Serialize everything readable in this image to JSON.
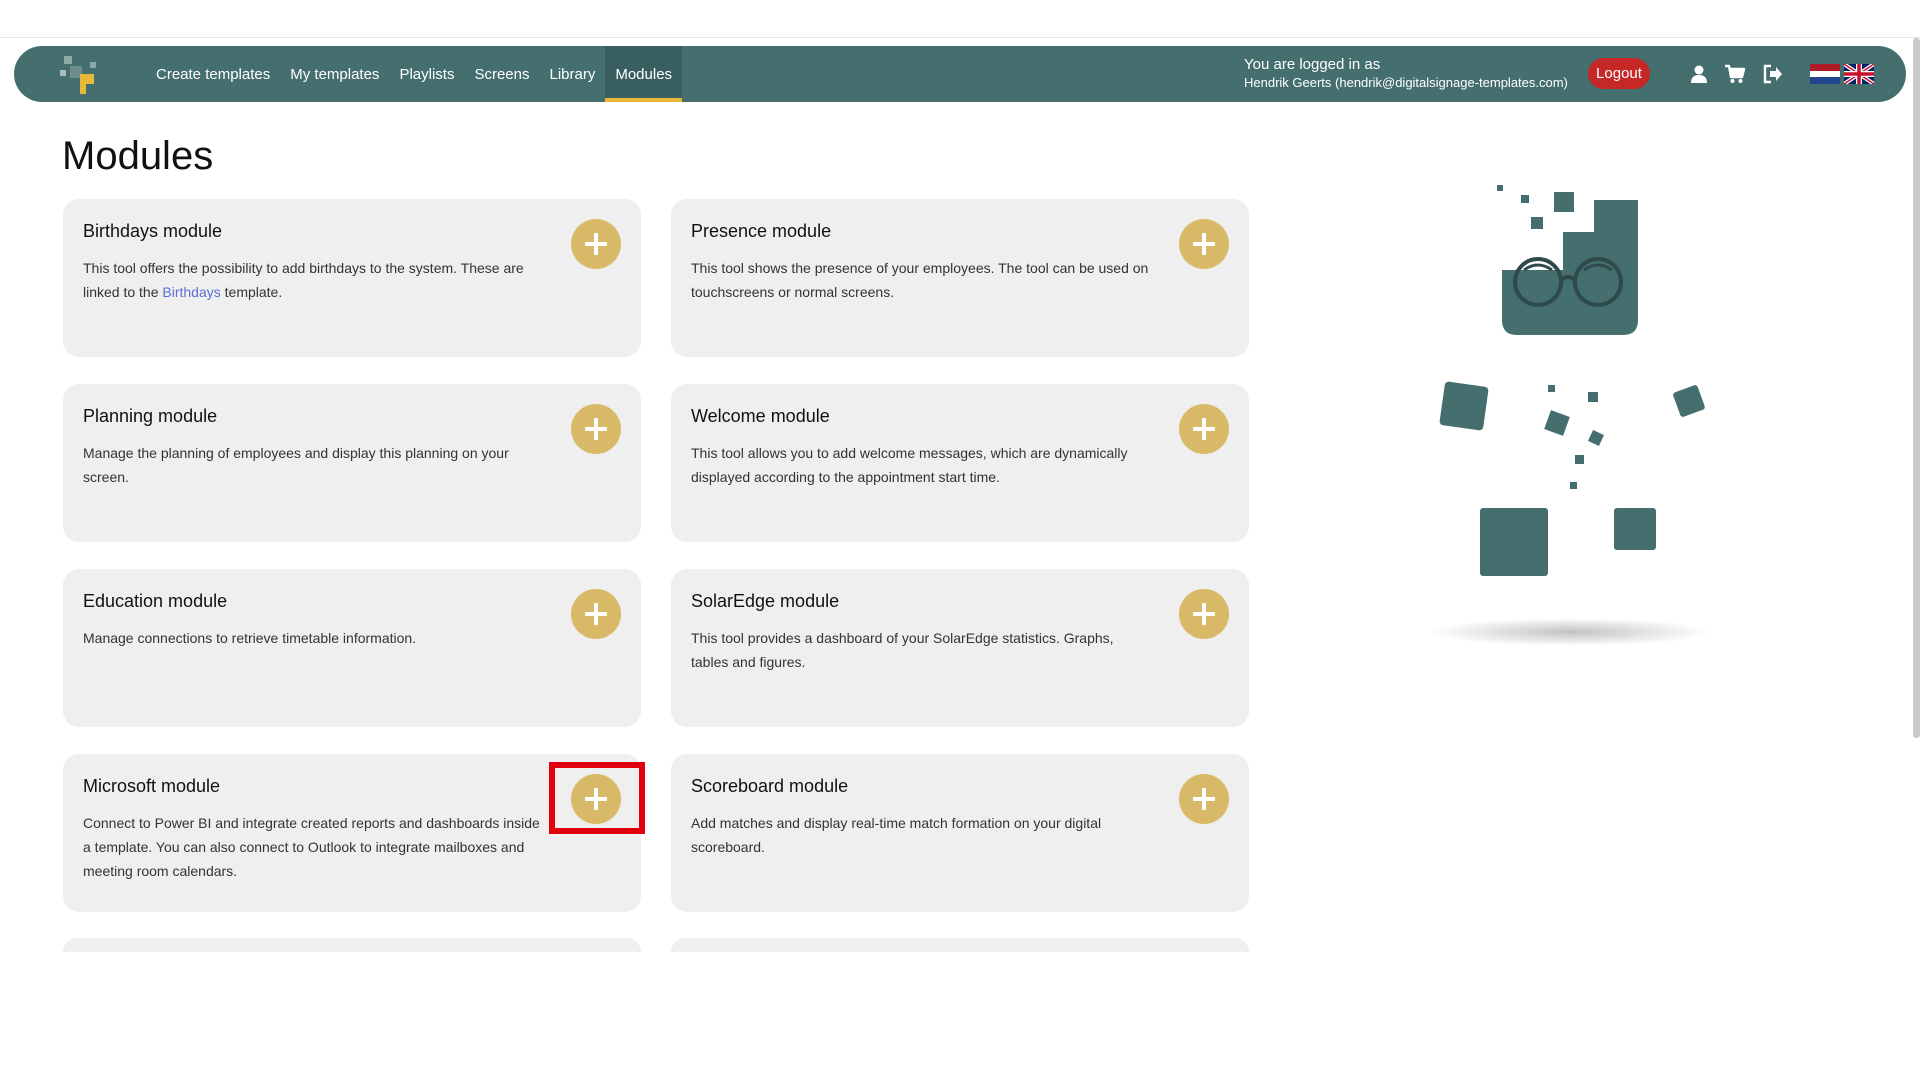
{
  "nav": {
    "links": [
      {
        "label": "Create templates"
      },
      {
        "label": "My templates"
      },
      {
        "label": "Playlists"
      },
      {
        "label": "Screens"
      },
      {
        "label": "Library"
      },
      {
        "label": "Modules",
        "active": true
      }
    ],
    "login_line1": "You are logged in as",
    "login_line2": "Hendrik Geerts (hendrik@digitalsignage-templates.com)",
    "logout_label": "Logout",
    "icons": [
      "user-icon",
      "cart-icon",
      "sign-out-icon"
    ],
    "flags": [
      "flag-netherlands-icon",
      "flag-uk-icon"
    ]
  },
  "page": {
    "title": "Modules"
  },
  "modules": [
    {
      "title": "Birthdays module",
      "desc_before": "This tool offers the possibility to add birthdays to the system. These are linked to the ",
      "desc_link": "Birthdays",
      "desc_after": " template."
    },
    {
      "title": "Presence module",
      "desc": "This tool shows the presence of your employees. The tool can be used on touchscreens or normal screens."
    },
    {
      "title": "Planning module",
      "desc": "Manage the planning of employees and display this planning on your screen."
    },
    {
      "title": "Welcome module",
      "desc": "This tool allows you to add welcome messages, which are dynamically displayed according to the appointment start time."
    },
    {
      "title": "Education module",
      "desc": "Manage connections to retrieve timetable information."
    },
    {
      "title": "SolarEdge module",
      "desc": "This tool provides a dashboard of your SolarEdge statistics. Graphs, tables and figures."
    },
    {
      "title": "Microsoft module",
      "desc": "Connect to  Power  BI and integrate created reports and dashboards inside a template. You can also connect to Outlook to integrate mailboxes and meeting room calendars."
    },
    {
      "title": "Scoreboard module",
      "desc": "Add matches and display real-time match formation on your digital scoreboard."
    }
  ],
  "colors": {
    "navbar": "#456e6f",
    "accent": "#e6b93a",
    "add_button": "#d8b968",
    "logout": "#c62828",
    "card_bg": "#efefef",
    "highlight": "#e0000e"
  }
}
